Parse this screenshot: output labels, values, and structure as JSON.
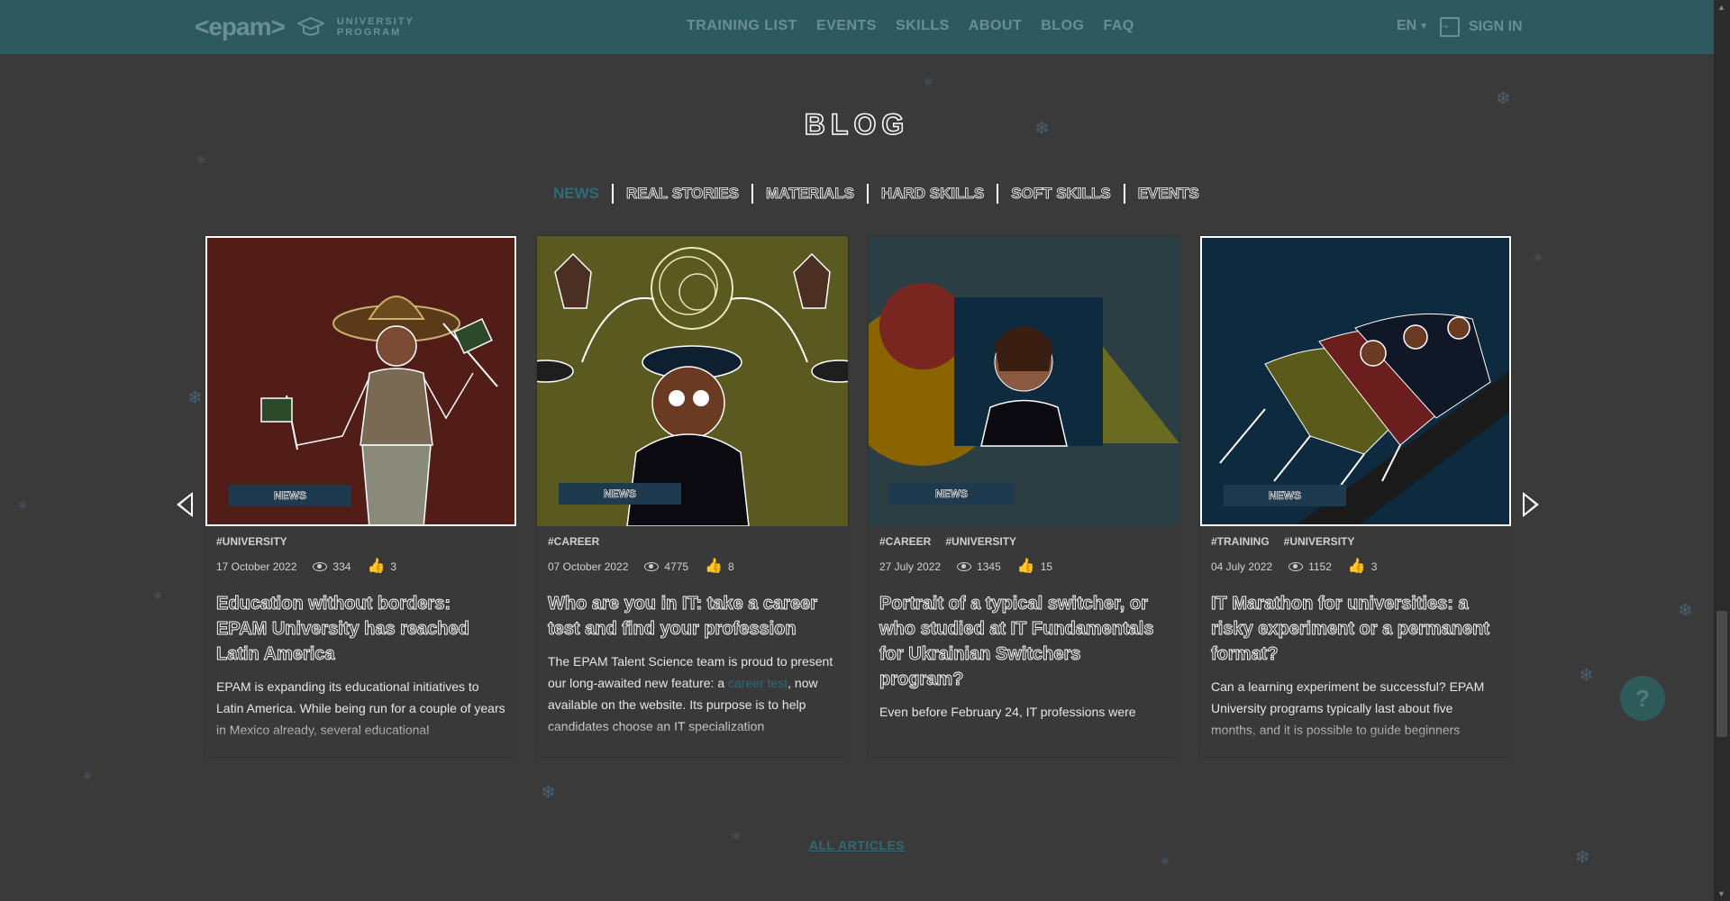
{
  "header": {
    "logo_text": "<epam>",
    "logo_sub_line1": "UNIVERSITY",
    "logo_sub_line2": "PROGRAM",
    "nav": [
      "TRAINING LIST",
      "EVENTS",
      "SKILLS",
      "ABOUT",
      "BLOG",
      "FAQ"
    ],
    "lang": "EN",
    "signin": "SIGN IN"
  },
  "page_title": "BLOG",
  "tabs": [
    "NEWS",
    "REAL STORIES",
    "MATERIALS",
    "HARD SKILLS",
    "SOFT SKILLS",
    "EVENTS"
  ],
  "active_tab": "NEWS",
  "cards": [
    {
      "badge": "NEWS",
      "tags": [
        "#UNIVERSITY"
      ],
      "date": "17 October 2022",
      "views": "334",
      "likes": "3",
      "title": "Education without borders: EPAM University has reached Latin America",
      "text_before": "EPAM is expanding its educational initiatives to Latin America. While being run for a couple of years in Mexico already, several educational",
      "link": "",
      "text_after": ""
    },
    {
      "badge": "NEWS",
      "tags": [
        "#CAREER"
      ],
      "date": "07 October 2022",
      "views": "4775",
      "likes": "8",
      "title": "Who are you in IT: take a career test and find your profession",
      "text_before": "The EPAM Talent Science team is proud to present our long-awaited new feature: a ",
      "link": "career test",
      "text_after": ", now available on the website. Its purpose is to help candidates choose an IT specialization"
    },
    {
      "badge": "NEWS",
      "tags": [
        "#CAREER",
        "#UNIVERSITY"
      ],
      "date": "27 July 2022",
      "views": "1345",
      "likes": "15",
      "title": "Portrait of a typical switcher, or who studied at IT Fundamentals for Ukrainian Switchers program?",
      "text_before": "Even before February 24, IT professions were",
      "link": "",
      "text_after": ""
    },
    {
      "badge": "NEWS",
      "tags": [
        "#TRAINING",
        "#UNIVERSITY"
      ],
      "date": "04 July 2022",
      "views": "1152",
      "likes": "3",
      "title": "IT Marathon for universities: a risky experiment or a permanent format?",
      "text_before": "Can a learning experiment be successful? EPAM University programs typically last about five months, and it is possible to guide beginners",
      "link": "",
      "text_after": ""
    }
  ],
  "all_articles": "ALL ARTICLES",
  "help": "?",
  "colors": {
    "header_bg": "#2e5a5f",
    "page_bg": "#3a3a3a",
    "accent": "#2e6a78",
    "card1_bg": "#521d16",
    "card2_bg": "#5a5a20",
    "card3_bg": "#2a3e44",
    "card4_bg": "#0e2a3e"
  }
}
